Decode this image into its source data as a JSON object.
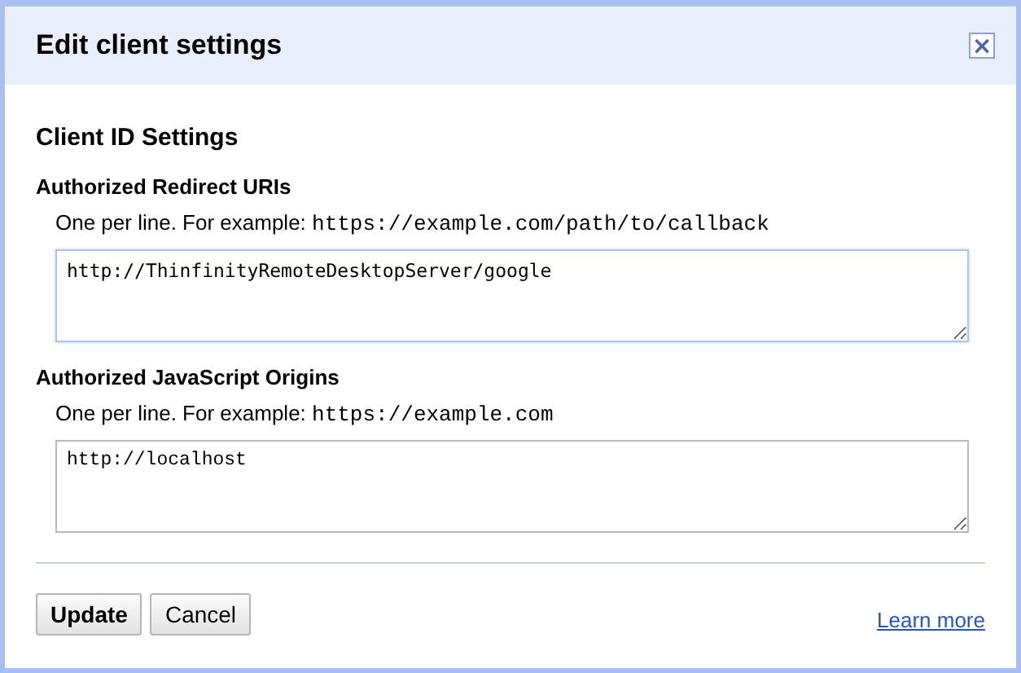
{
  "dialog": {
    "title": "Edit client settings",
    "close_label": "×"
  },
  "section_title": "Client ID Settings",
  "fields": [
    {
      "label": "Authorized Redirect URIs",
      "hint": "One per line. For example: ",
      "example": "https://example.com/path/to/callback",
      "value": "http://ThinfinityRemoteDesktopServer/google",
      "focused": true
    },
    {
      "label": "Authorized JavaScript Origins",
      "hint": "One per line. For example: ",
      "example": "https://example.com",
      "value": "http://localhost",
      "focused": false
    }
  ],
  "buttons": [
    {
      "label": "Update",
      "primary": true
    },
    {
      "label": "Cancel",
      "primary": false
    }
  ],
  "link": "Learn more"
}
